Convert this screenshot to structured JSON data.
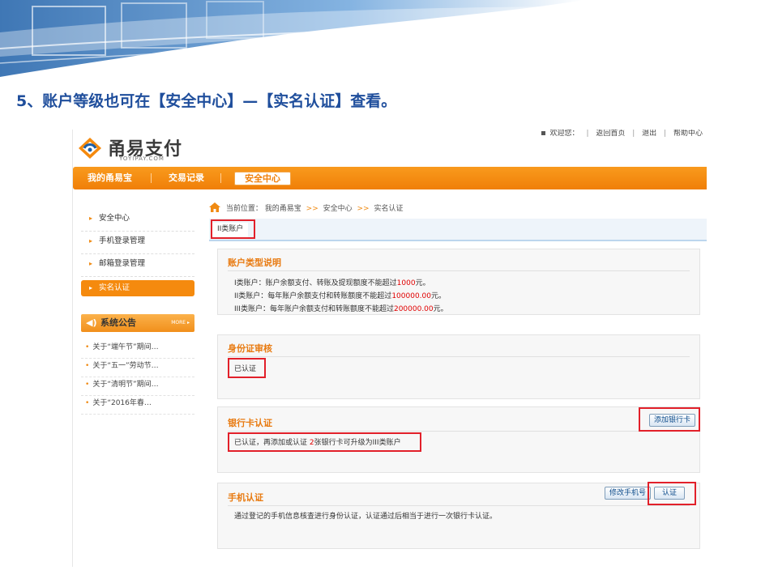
{
  "slide": {
    "title": "5、账户等级也可在【安全中心】—【实名认证】查看。"
  },
  "site": {
    "logo_name": "甬易支付",
    "logo_sub": "YOYIPAY.COM",
    "toplinks": [
      "欢迎您：",
      "返回首页",
      "退出",
      "帮助中心"
    ]
  },
  "nav": {
    "items": [
      "我的甬易宝",
      "交易记录",
      "安全中心"
    ],
    "active_index": 2
  },
  "sidebar": {
    "items": [
      "安全中心",
      "手机登录管理",
      "邮箱登录管理",
      "实名认证"
    ],
    "active_index": 3,
    "notice_title": "系统公告",
    "notice_more": "MORE",
    "notices": [
      "关于“端午节”期间…",
      "关于“五一”劳动节…",
      "关于“清明节”期间…",
      "关于“2016年春…"
    ]
  },
  "breadcrumb": {
    "label": "当前位置：",
    "parts": [
      "我的甬易宝",
      "安全中心",
      "实名认证"
    ],
    "separator": ">>"
  },
  "tab": {
    "label": "II类账户"
  },
  "account_types": {
    "title": "账户类型说明",
    "lines": [
      {
        "prefix": "I类账户：账户余额支付、转账及提现额度不能超过",
        "amount": "1000",
        "suffix": "元。"
      },
      {
        "prefix": "II类账户：每年账户余额支付和转账额度不能超过",
        "amount": "100000.00",
        "suffix": "元。"
      },
      {
        "prefix": "III类账户：每年账户余额支付和转账额度不能超过",
        "amount": "200000.00",
        "suffix": "元。"
      }
    ]
  },
  "id_check": {
    "title": "身份证审核",
    "status": "已认证"
  },
  "bank_card": {
    "title": "银行卡认证",
    "button": "添加银行卡",
    "status_prefix": "已认证，再添加或认证 ",
    "count": "2",
    "status_suffix": "张银行卡可升级为III类账户"
  },
  "phone": {
    "title": "手机认证",
    "modify_button": "修改手机号",
    "verify_button": "认证",
    "desc": "通过登记的手机信息核查进行身份认证，认证通过后相当于进行一次银行卡认证。"
  },
  "colors": {
    "accent_orange": "#f58a0e",
    "highlight_red": "#e2202a",
    "title_blue": "#1f4e9c",
    "amount_red": "#e00000"
  }
}
